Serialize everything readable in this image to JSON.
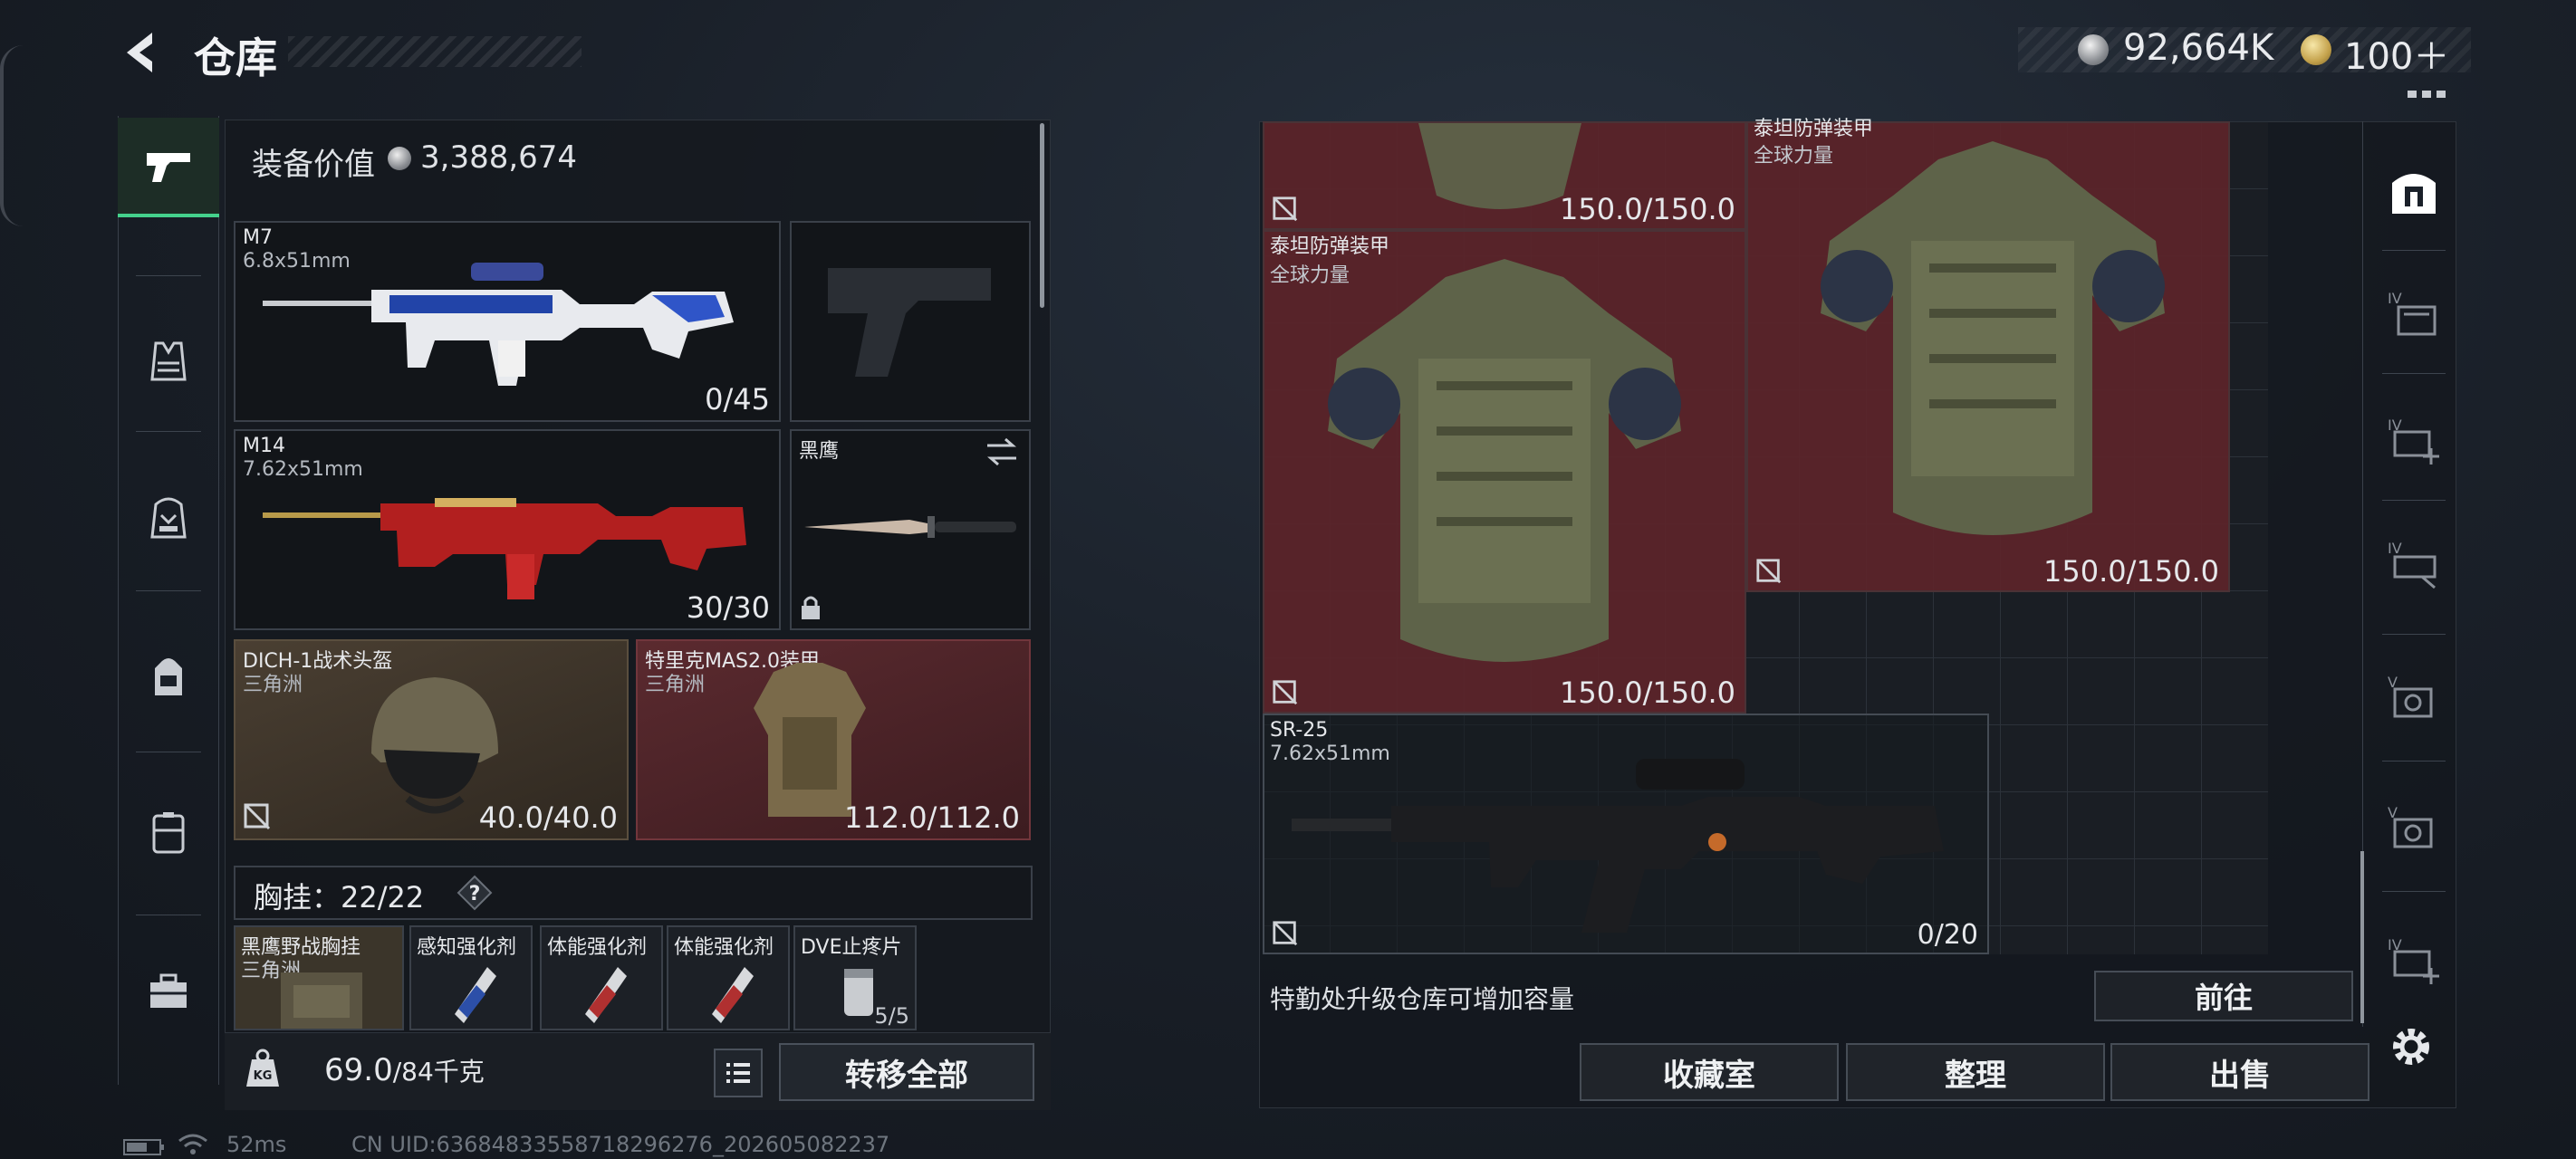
{
  "header": {
    "title": "仓库",
    "currency_silver": "92,664K",
    "currency_gold": "100＋"
  },
  "left_rail": {
    "items": [
      {
        "icon": "pistol-icon",
        "active": true
      },
      {
        "icon": "vest-icon",
        "active": false
      },
      {
        "icon": "helmet-bag-icon",
        "active": false
      },
      {
        "icon": "backpack-icon",
        "active": false
      },
      {
        "icon": "container-icon",
        "active": false
      },
      {
        "icon": "toolbox-icon",
        "active": false
      }
    ]
  },
  "loadout": {
    "equip_value_label": "装备价值",
    "equip_value": "3,388,674",
    "primary": {
      "name": "M7",
      "caliber": "6.8x51mm",
      "count": "0/45"
    },
    "secondary": {
      "name": "M14",
      "caliber": "7.62x51mm",
      "count": "30/30"
    },
    "melee": {
      "name": "黑鹰"
    },
    "helmet": {
      "name": "DICH-1战术头盔",
      "source": "三角洲",
      "durability": "40.0/40.0"
    },
    "armor": {
      "name": "特里克MAS2.0装甲",
      "source": "三角洲",
      "durability": "112.0/112.0"
    },
    "chest_rig_label": "胸挂：",
    "chest_rig_capacity": "22/22",
    "help_glyph": "?",
    "rig_items": [
      {
        "name": "黑鹰野战胸挂",
        "sub": "三角洲"
      },
      {
        "name": "感知强化剂",
        "sub": ""
      },
      {
        "name": "体能强化剂",
        "sub": ""
      },
      {
        "name": "体能强化剂",
        "sub": ""
      },
      {
        "name": "DVE止疼片",
        "sub": "5/5"
      }
    ],
    "weight": "69.0",
    "weight_max": "/84千克",
    "transfer_all": "转移全部"
  },
  "storage": {
    "items": [
      {
        "name": "",
        "sub": "",
        "count": "150.0/150.0"
      },
      {
        "name": "泰坦防弹装甲",
        "sub": "全球力量",
        "count": "150.0/150.0"
      },
      {
        "name": "泰坦防弹装甲",
        "sub": "全球力量",
        "count": "150.0/150.0"
      },
      {
        "name": "SR-25",
        "sub": "7.62x51mm",
        "count": "0/20"
      }
    ],
    "upgrade_note": "特勤处升级仓库可增加容量",
    "goto": "前往",
    "buttons": {
      "collection": "收藏室",
      "sort": "整理",
      "sell": "出售"
    }
  },
  "right_rail": {
    "items": [
      "safe-icon",
      "storage-iv-icon",
      "storage-iv-add-icon",
      "storage-iv-icon",
      "storage-v-icon",
      "storage-v-icon",
      "storage-iv-add-icon"
    ],
    "item_labels": [
      "",
      "IV",
      "IV",
      "IV",
      "V",
      "V",
      "IV"
    ]
  },
  "status": {
    "ping": "52ms",
    "uid": "CN UID:63684833558718296276_202605082237"
  },
  "colors": {
    "accent_green": "#44d18c",
    "item_red": "#5c242a",
    "helmet_brown": "#4a3f32"
  }
}
